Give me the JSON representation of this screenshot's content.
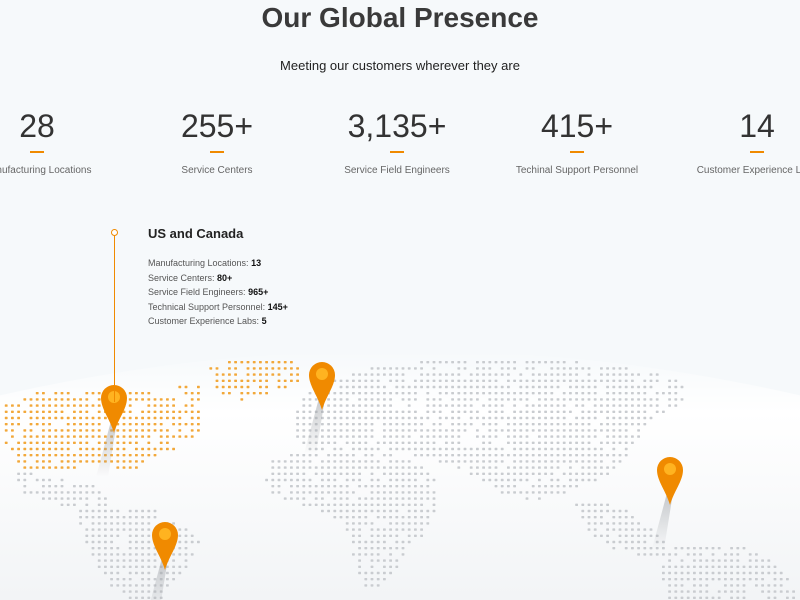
{
  "header": {
    "title": "Our Global Presence",
    "subtitle": "Meeting our customers wherever they are"
  },
  "stats": [
    {
      "value": "28",
      "label": "Manufacturing Locations"
    },
    {
      "value": "255+",
      "label": "Service Centers"
    },
    {
      "value": "3,135+",
      "label": "Service Field Engineers"
    },
    {
      "value": "415+",
      "label": "Techinal Support Personnel"
    },
    {
      "value": "14",
      "label": "Customer Experience Labs"
    }
  ],
  "region": {
    "title": "US and Canada",
    "rows": [
      {
        "label": "Manufacturing Locations:",
        "value": "13"
      },
      {
        "label": "Service Centers:",
        "value": "80+"
      },
      {
        "label": "Service Field Engineers:",
        "value": "965+"
      },
      {
        "label": "Technical Support Personnel:",
        "value": "145+"
      },
      {
        "label": "Customer Experience Labs:",
        "value": "5"
      }
    ]
  },
  "colors": {
    "accent": "#f08a00",
    "highlight_dots": "#f2a83a",
    "map_dots": "#c9ccd0",
    "background": "#f6f9fb"
  },
  "map": {
    "pins": [
      {
        "name": "map-pin-north-america",
        "icon": "map-pin-icon"
      },
      {
        "name": "map-pin-europe",
        "icon": "map-pin-icon"
      },
      {
        "name": "map-pin-south-america",
        "icon": "map-pin-icon"
      },
      {
        "name": "map-pin-asia-pacific",
        "icon": "map-pin-icon"
      }
    ]
  }
}
